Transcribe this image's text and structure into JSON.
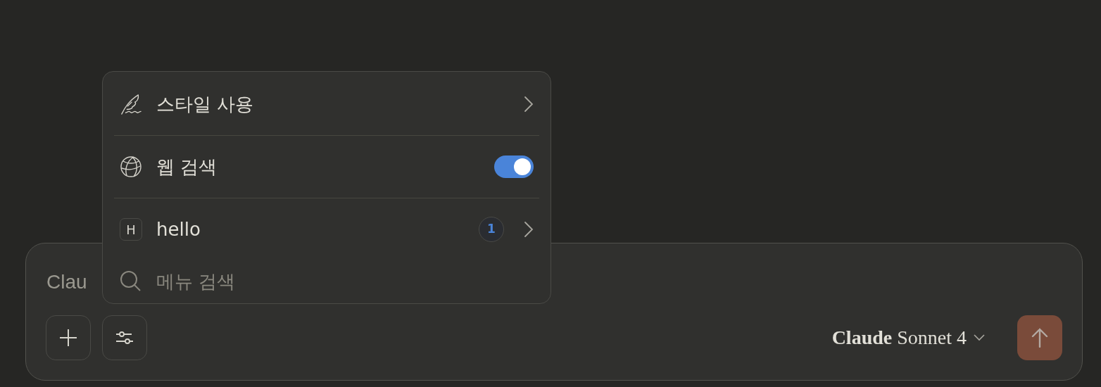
{
  "composer": {
    "placeholder": "Clau",
    "model": "**Claude** Sonnet 4"
  },
  "menu": {
    "items": [
      {
        "kind": "style",
        "label": "스타일 사용"
      },
      {
        "kind": "toggle",
        "label": "웹 검색",
        "on": true
      },
      {
        "kind": "project",
        "letter": "H",
        "label": "hello",
        "badge": "1"
      }
    ],
    "search": {
      "placeholder": "메뉴 검색"
    }
  }
}
